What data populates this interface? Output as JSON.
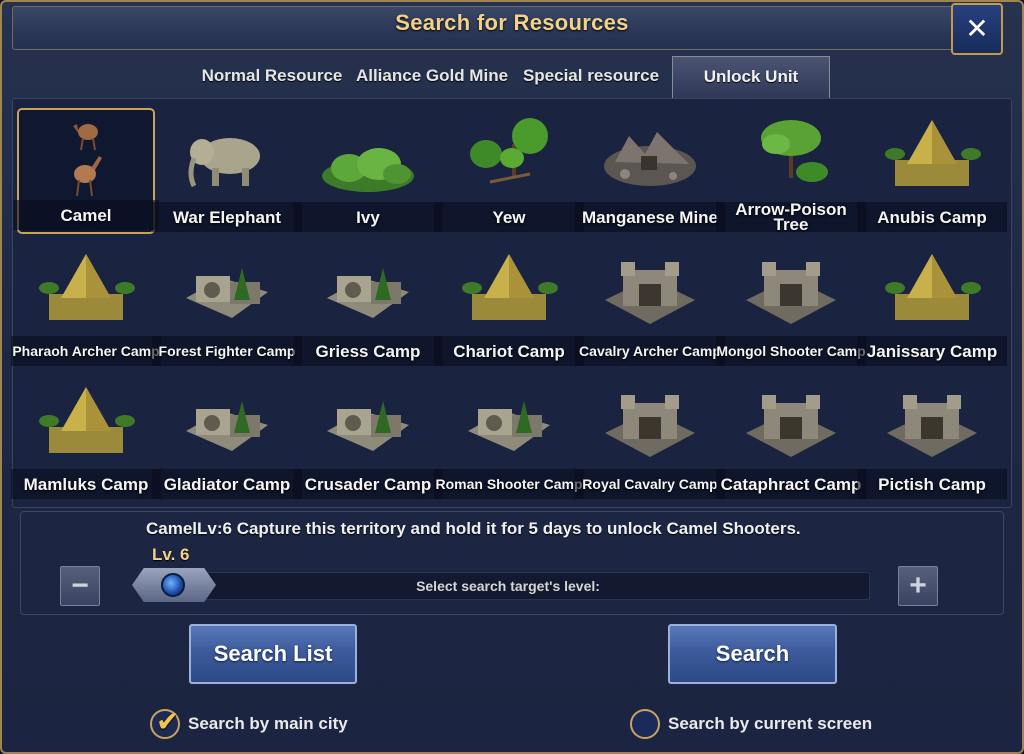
{
  "title": "Search for Resources",
  "tabs": [
    {
      "label": "Normal Resource"
    },
    {
      "label": "Alliance Gold Mine"
    },
    {
      "label": "Special resource"
    },
    {
      "label": "Unlock Unit"
    }
  ],
  "active_tab": "Unlock Unit",
  "items": [
    {
      "label": "Camel",
      "icon": "camel-icon"
    },
    {
      "label": "War Elephant",
      "icon": "elephant-icon"
    },
    {
      "label": "Ivy",
      "icon": "ivy-icon"
    },
    {
      "label": "Yew",
      "icon": "yew-icon"
    },
    {
      "label": "Manganese Mine",
      "icon": "mine-icon"
    },
    {
      "label": "Arrow-Poison Tree",
      "icon": "tree-icon"
    },
    {
      "label": "Anubis Camp",
      "icon": "pyramid-camp-icon"
    },
    {
      "label": "Pharaoh Archer Camp",
      "icon": "pyramid-camp-icon"
    },
    {
      "label": "Forest Fighter Camp",
      "icon": "fortress-camp-icon"
    },
    {
      "label": "Griess Camp",
      "icon": "fortress-camp-icon"
    },
    {
      "label": "Chariot Camp",
      "icon": "pyramid-camp-icon"
    },
    {
      "label": "Cavalry Archer Camp",
      "icon": "stone-camp-icon"
    },
    {
      "label": "Mongol Shooter Camp",
      "icon": "stone-camp-icon"
    },
    {
      "label": "Janissary Camp",
      "icon": "pyramid-camp-icon"
    },
    {
      "label": "Mamluks Camp",
      "icon": "pyramid-camp-icon"
    },
    {
      "label": "Gladiator Camp",
      "icon": "fortress-camp-icon"
    },
    {
      "label": "Crusader Camp",
      "icon": "fortress-camp-icon"
    },
    {
      "label": "Roman Shooter Camp",
      "icon": "fortress-camp-icon"
    },
    {
      "label": "Royal Cavalry Camp",
      "icon": "stone-camp-icon"
    },
    {
      "label": "Cataphract Camp",
      "icon": "stone-camp-icon"
    },
    {
      "label": "Pictish Camp",
      "icon": "stone-camp-icon"
    }
  ],
  "selected_item": "Camel",
  "info": {
    "description": "CamelLv:6 Capture this territory and hold it for 5 days to unlock Camel Shooters.",
    "level_label": "Lv. 6",
    "slider_caption": "Select search target's level:",
    "level": 6,
    "minus_symbol": "−",
    "plus_symbol": "+"
  },
  "buttons": {
    "search_list": "Search List",
    "search": "Search"
  },
  "options": {
    "main_city": "Search by main city",
    "current_screen": "Search by current screen",
    "main_city_checked": true,
    "current_screen_checked": false
  },
  "colors": {
    "gold": "#f2d28a",
    "panel": "#1a2340",
    "button_blue": "#3d5b9c",
    "border_gold": "#c7a45c"
  }
}
